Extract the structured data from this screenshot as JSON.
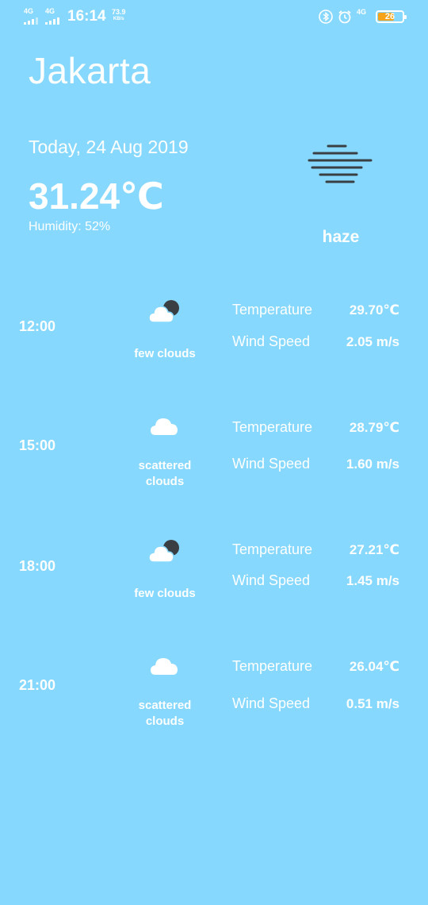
{
  "status_bar": {
    "signal1_label": "4G",
    "signal2_label": "4G",
    "time": "16:14",
    "net_speed": "73.9",
    "net_speed_unit": "KB/s",
    "signal3_label": "4G",
    "battery_level": "26",
    "battery_color": "#f5a31a",
    "icons": [
      "bluetooth-icon",
      "alarm-icon"
    ]
  },
  "header": {
    "city": "Jakarta",
    "date": "Today, 24 Aug 2019",
    "temperature": "31.24℃",
    "humidity": "Humidity: 52%",
    "condition": "haze",
    "condition_icon": "haze-icon"
  },
  "forecast": [
    {
      "time": "12:00",
      "icon": "few-clouds-icon",
      "desc_line1": "few clouds",
      "desc_line2": "",
      "temp_label": "Temperature",
      "temp_value": "29.70℃",
      "wind_label": "Wind Speed",
      "wind_value": "2.05 m/s"
    },
    {
      "time": "15:00",
      "icon": "scattered-clouds-icon",
      "desc_line1": "scattered",
      "desc_line2": "clouds",
      "temp_label": "Temperature",
      "temp_value": "28.79℃",
      "wind_label": "Wind Speed",
      "wind_value": "1.60 m/s"
    },
    {
      "time": "18:00",
      "icon": "few-clouds-icon",
      "desc_line1": "few clouds",
      "desc_line2": "",
      "temp_label": "Temperature",
      "temp_value": "27.21℃",
      "wind_label": "Wind Speed",
      "wind_value": "1.45 m/s"
    },
    {
      "time": "21:00",
      "icon": "scattered-clouds-icon",
      "desc_line1": "scattered",
      "desc_line2": "clouds",
      "temp_label": "Temperature",
      "temp_value": "26.04℃",
      "wind_label": "Wind Speed",
      "wind_value": "0.51 m/s"
    }
  ],
  "colors": {
    "background": "#86d8fe",
    "text": "#ffffff",
    "icon_dark": "#3a3f44"
  }
}
